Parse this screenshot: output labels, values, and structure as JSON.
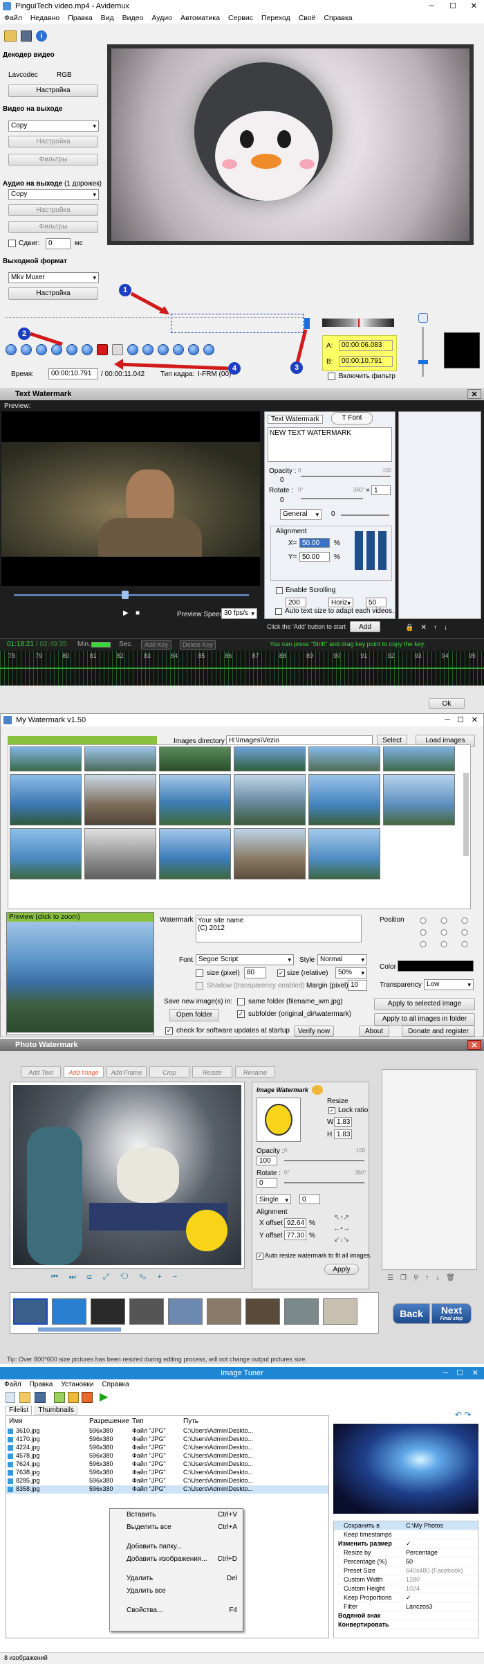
{
  "avidemux": {
    "title": "PinguiTech video.mp4 - Avidemux",
    "menu": [
      "Файл",
      "Недавно",
      "Правка",
      "Вид",
      "Видео",
      "Аудио",
      "Автоматика",
      "Сервис",
      "Переход",
      "Своё",
      "Справка"
    ],
    "decoder_title": "Декодер видео",
    "lavcodec": "Lavcodec",
    "rgb": "RGB",
    "settings": "Настройка",
    "video_out_title": "Видео на выходе",
    "video_copy": "Copy",
    "video_settings": "Настройка",
    "video_filters": "Фильтры",
    "audio_out_title": "Аудио на выходе",
    "audio_tracks": "(1 дорожек)",
    "audio_copy": "Copy",
    "audio_settings": "Настройка",
    "audio_filters": "Фильтры",
    "shift_label": "Сдвиг:",
    "shift_value": "0",
    "shift_unit": "мс",
    "format_title": "Выходной формат",
    "format_value": "Mkv Muxer",
    "format_settings": "Настройка",
    "time_label": "Время:",
    "time_value": "00:00:10.791",
    "time_total": "/ 00:00:11.042",
    "frame_type": "Тип кадра:",
    "frame_value": "I-FRM (00)",
    "marker_a_label": "A:",
    "marker_a": "00:00:06.083",
    "marker_b_label": "B:",
    "marker_b": "00:00:10.791",
    "filter_toggle": "Включить фильтр",
    "callouts": [
      "1",
      "2",
      "3",
      "4"
    ]
  },
  "text_watermark": {
    "title": "Text Watermark",
    "preview_label": "Preview:",
    "tab_text": "Text Watermark",
    "tab_font": "Font",
    "text_value": "NEW TEXT WATERMARK",
    "opacity_label": "Opacity :",
    "opacity_min": "0",
    "opacity_max": "100",
    "opacity_value": "0",
    "rotate_label": "Rotate :",
    "rotate_min": "0°",
    "rotate_max": "360°",
    "rotate_x": "×",
    "rotate_x_value": "1",
    "rotate_value": "0",
    "mode": "General",
    "mode_value": "0",
    "alignment_label": "Alignment",
    "x_label": "X=",
    "x_value": "50.00",
    "y_label": "Y=",
    "y_value": "50.00",
    "pct": "%",
    "scroll_label": "Enable Scrolling",
    "scroll_value": "200",
    "scroll_dir": "Horiz",
    "scroll_speed": "50",
    "hint_add": "Click the 'Add' button to start",
    "add_button": "Add",
    "auto_size": "Auto text size to adapt each videos.",
    "preview_speed": "Preview Speed:",
    "preview_speed_value": "30 fps/s",
    "time_current": "01:18:21",
    "time_end": "/ 02:49:35",
    "min_label": "Min.",
    "sec_label": "Sec.",
    "add_key": "Add Key",
    "delete_key": "Delete Key",
    "key_hint": "You can press \"Shift\" and drag key point to copy the key.",
    "ruler": [
      "78",
      "79",
      "80",
      "81",
      "82",
      "83",
      "84",
      "85",
      "86",
      "87",
      "88",
      "89",
      "90",
      "91",
      "92",
      "93",
      "94",
      "95"
    ],
    "ok": "Ok"
  },
  "my_watermark": {
    "title": "My Watermark v1.50",
    "images_dir_label": "Images directory",
    "images_dir_value": "H:\\Images\\Vezio",
    "select": "Select",
    "load_images": "Load images",
    "preview_label": "Preview (click to zoom)",
    "watermark_label": "Watermark",
    "watermark_text": "Your site name\n(C) 2012",
    "font_label": "Font",
    "font_value": "Segoe Script",
    "style_label": "Style",
    "style_value": "Normal",
    "size_pixel_label": "size (pixel)",
    "size_pixel_value": "80",
    "size_rel_label": "size (relative)",
    "size_rel_value": "50%",
    "shadow_label": "Shadow (transparency enabled)",
    "margin_label": "Margin (pixel)",
    "margin_value": "10",
    "save_label": "Save new image(s) in:",
    "same_folder": "same folder (filename_wm.jpg)",
    "open_folder": "Open folder",
    "subfolder": "subfolder (original_dir\\watermark)",
    "position_label": "Position",
    "color_label": "Color",
    "transparency_label": "Transparency",
    "transparency_value": "Low",
    "apply_selected": "Apply to selected image",
    "apply_all": "Apply to all images in folder",
    "updates": "check for software updates at startup",
    "verify": "Verify now",
    "about": "About",
    "donate": "Donate and register"
  },
  "photo_watermark": {
    "title": "Photo Watermark",
    "tabs": [
      "Add Text",
      "Add Image",
      "Add Frame",
      "Crop",
      "Resize",
      "Rename"
    ],
    "image_watermark": "Image Watermark",
    "resize_label": "Resize",
    "lock_ratio": "Lock ratio",
    "w_label": "W",
    "w_value": "1.83",
    "h_label": "H",
    "h_value": "1.83",
    "opacity_label": "Opacity :",
    "opacity_value": "100",
    "opacity_min": "0",
    "opacity_max": "100",
    "rotate_label": "Rotate :",
    "rotate_value": "0",
    "rotate_min": "0°",
    "rotate_max": "360°",
    "mode": "Single",
    "mode_value": "0",
    "alignment": "Alignment",
    "xoffset_label": "X offset",
    "xoffset_value": "92.64",
    "yoffset_label": "Y offset",
    "yoffset_value": "77.30",
    "pct": "%",
    "auto_resize": "Auto resize watermark to fit all images.",
    "apply": "Apply",
    "back": "Back",
    "next": "Next",
    "final_step": "Final step",
    "tip": "Tip: Over 800*600 size pictures has been resized during editing process, will not change output pictures size."
  },
  "image_tuner": {
    "title": "Image Tuner",
    "menu": [
      "Файл",
      "Правка",
      "Установки",
      "Справка"
    ],
    "tabs": [
      "Filelist",
      "Thumbnails"
    ],
    "columns": [
      "Имя",
      "Разрешение",
      "Тип",
      "Путь"
    ],
    "rows": [
      {
        "name": "3610.jpg",
        "res": "596x380",
        "type": "Файл \"JPG\"",
        "path": "C:\\Users\\Admin\\Deskto..."
      },
      {
        "name": "4170.jpg",
        "res": "596x380",
        "type": "Файл \"JPG\"",
        "path": "C:\\Users\\Admin\\Deskto..."
      },
      {
        "name": "4224.jpg",
        "res": "596x380",
        "type": "Файл \"JPG\"",
        "path": "C:\\Users\\Admin\\Deskto..."
      },
      {
        "name": "4578.jpg",
        "res": "596x380",
        "type": "Файл \"JPG\"",
        "path": "C:\\Users\\Admin\\Deskto..."
      },
      {
        "name": "7624.jpg",
        "res": "596x380",
        "type": "Файл \"JPG\"",
        "path": "C:\\Users\\Admin\\Deskto..."
      },
      {
        "name": "7638.jpg",
        "res": "596x380",
        "type": "Файл \"JPG\"",
        "path": "C:\\Users\\Admin\\Deskto..."
      },
      {
        "name": "8285.jpg",
        "res": "596x380",
        "type": "Файл \"JPG\"",
        "path": "C:\\Users\\Admin\\Deskto..."
      },
      {
        "name": "8358.jpg",
        "res": "596x380",
        "type": "Файл \"JPG\"",
        "path": "C:\\Users\\Admin\\Deskto..."
      }
    ],
    "context_menu": [
      {
        "label": "Вставить",
        "key": "Ctrl+V"
      },
      {
        "label": "Выделить все",
        "key": "Ctrl+A"
      },
      {
        "label": "Добавить папку...",
        "key": ""
      },
      {
        "label": "Добавить изображения...",
        "key": "Ctrl+D"
      },
      {
        "label": "Удалить",
        "key": "Del"
      },
      {
        "label": "Удалить все",
        "key": ""
      },
      {
        "label": "Свойства...",
        "key": "F4"
      }
    ],
    "props": [
      {
        "k": "Сохранить в",
        "v": "C:\\My Photos",
        "bold": false,
        "sel": true
      },
      {
        "k": "Keep timestamps",
        "v": "",
        "bold": false
      },
      {
        "k": "Изменить размер",
        "v": "✓",
        "bold": true
      },
      {
        "k": "Resize by",
        "v": "Percentage",
        "bold": false
      },
      {
        "k": "Percentage (%)",
        "v": "50",
        "bold": false
      },
      {
        "k": "Preset Size",
        "v": "640x480 (Facebook)",
        "bold": false,
        "gray": true
      },
      {
        "k": "Custom Width",
        "v": "1280",
        "bold": false,
        "gray": true
      },
      {
        "k": "Custom Height",
        "v": "1024",
        "bold": false,
        "gray": true
      },
      {
        "k": "Keep Proportions",
        "v": "✓",
        "bold": false
      },
      {
        "k": "Filter",
        "v": "Lanczos3",
        "bold": false
      },
      {
        "k": "Водяной знак",
        "v": "",
        "bold": true
      },
      {
        "k": "Конвертировать",
        "v": "",
        "bold": true
      }
    ],
    "status": "8 изображений"
  },
  "colors": {
    "accent": "#3a73c4",
    "highlight": "#ffff66",
    "red": "#d21a1a"
  }
}
